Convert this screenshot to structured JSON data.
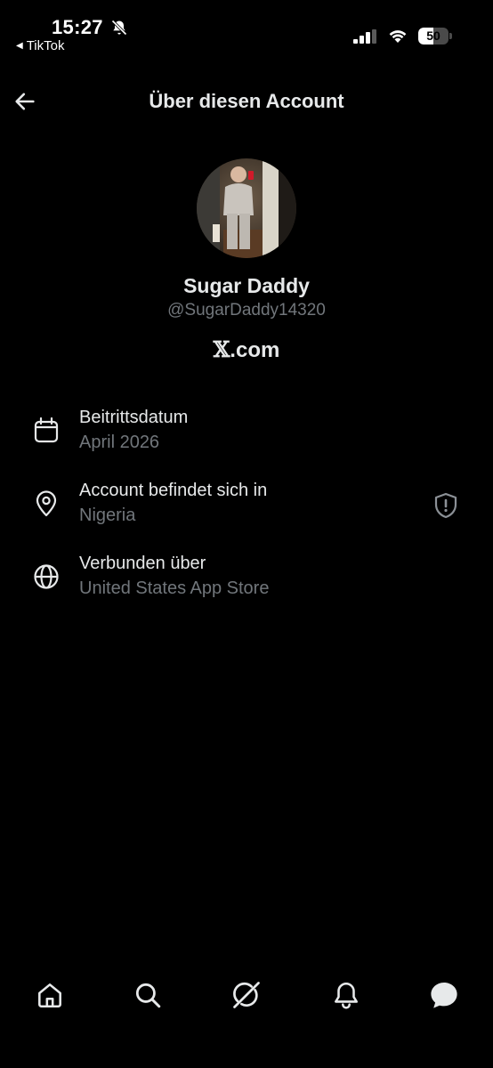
{
  "status_bar": {
    "time": "15:27",
    "back_app": "TikTok",
    "battery_level": 50,
    "battery_label": "50",
    "icons": [
      "bell-off-icon",
      "signal-icon",
      "wifi-icon",
      "battery-icon"
    ]
  },
  "header": {
    "title": "Über diesen Account",
    "back_icon": "arrow-left-icon"
  },
  "profile": {
    "display_name": "Sugar Daddy",
    "handle": "@SugarDaddy14320",
    "domain_x": "𝕏",
    "domain_suffix": ".com"
  },
  "info": [
    {
      "icon": "calendar-icon",
      "label": "Beitrittsdatum",
      "value": "April 2026"
    },
    {
      "icon": "location-pin-icon",
      "label": "Account befindet sich in",
      "value": "Nigeria",
      "action_icon": "shield-exclamation-icon"
    },
    {
      "icon": "globe-icon",
      "label": "Verbunden über",
      "value": "United States App Store"
    }
  ],
  "bottom_nav": {
    "items": [
      "home-icon",
      "search-icon",
      "grok-icon",
      "notifications-icon",
      "messages-icon"
    ]
  },
  "colors": {
    "background": "#000000",
    "primary_text": "#e7e9ea",
    "secondary_text": "#71767b"
  }
}
